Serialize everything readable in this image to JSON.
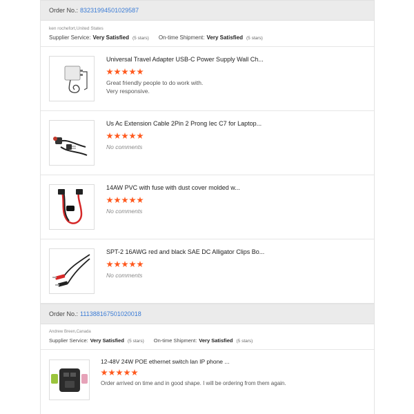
{
  "orders": [
    {
      "order_label": "Order No.:",
      "order_number": "83231994501029587",
      "buyer": "ken rochefort,United States",
      "supplier_service_label": "Supplier Service:",
      "supplier_service_value": "Very Satisfied",
      "supplier_service_stars": "(5 stars)",
      "shipment_label": "On-time Shipment:",
      "shipment_value": "Very Satisfied",
      "shipment_stars": "(5 stars)",
      "items": [
        {
          "title": "Universal Travel Adapter USB-C Power Supply Wall Ch...",
          "rating": 5,
          "comment_line1": "Great friendly people to do work with.",
          "comment_line2": "Very responsive.",
          "icon": "power-adapter-icon"
        },
        {
          "title": "Us Ac Extension Cable 2Pin 2 Prong Iec C7 for Laptop...",
          "rating": 5,
          "comment_line1": "No comments",
          "icon": "extension-cable-icon"
        },
        {
          "title": "14AW PVC with fuse with dust cover molded w...",
          "rating": 5,
          "comment_line1": "No comments",
          "icon": "fuse-cable-icon"
        },
        {
          "title": "SPT-2 16AWG red and black SAE DC Alligator Clips Bo...",
          "rating": 5,
          "comment_line1": "No comments",
          "icon": "alligator-clips-icon"
        }
      ]
    },
    {
      "order_label": "Order No.:",
      "order_number": "111388167501020018",
      "buyer": "Andrew Breen,Canada",
      "supplier_service_label": "Supplier Service:",
      "supplier_service_value": "Very Satisfied",
      "supplier_service_stars": "(5 stars)",
      "shipment_label": "On-time Shipment:",
      "shipment_value": "Very Satisfied",
      "shipment_stars": "(5 stars)",
      "items": [
        {
          "title": "12-48V 24W POE ethernet switch lan IP phone ...",
          "rating": 5,
          "comment_line1": "Order arrived on time and in good shape. I will be ordering from them again.",
          "icon": "poe-switch-icon"
        }
      ]
    }
  ],
  "colors": {
    "accent_link": "#3a7bd5",
    "star": "#ff5a1f",
    "header_bg": "#ebebeb"
  }
}
